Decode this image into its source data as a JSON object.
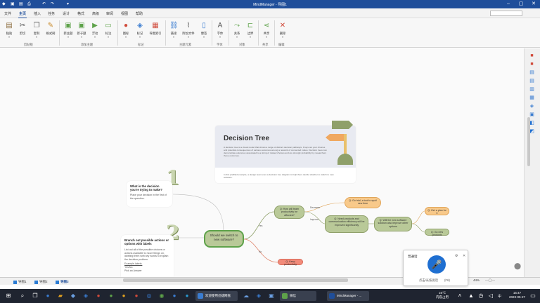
{
  "window": {
    "title": "MindManager - 导图1"
  },
  "menu": {
    "tabs": [
      "文件",
      "主页",
      "插入",
      "任务",
      "设计",
      "格式",
      "高级",
      "审阅",
      "视图",
      "帮助"
    ]
  },
  "ribbon": {
    "buttons": [
      "粘贴",
      "剪切",
      "复制",
      "格式刷",
      "新主题",
      "新子题",
      "浮动",
      "标注",
      "图标",
      "标记",
      "导图索引",
      "链接",
      "附加文件",
      "便签",
      "字体",
      "关系",
      "边界",
      "共享",
      "删除"
    ],
    "groups": [
      "剪贴板",
      "添加主题",
      "标记",
      "主题元素",
      "字体",
      "对象",
      "共享",
      "编辑"
    ]
  },
  "doc": {
    "title": "Decision Tree",
    "body": "A decision tree is a visual model that shows a range of distinct decision pathways. It lays out your choices and potential consequences of various outcomes among a network of connected nodes. Decision trees can demonstrate outcomes associated to a string of related choices and are strongly probability by researchers these outcomes.",
    "note": "In this prefilled example, a design team uses a decision tree diagram to help them decide whether to switch to new software."
  },
  "steps": [
    {
      "number": "1",
      "title": "What is the decision you're trying to make?",
      "text": "Place your decision in the first of the question."
    },
    {
      "number": "2",
      "title": "Branch out possible actions or options with labels",
      "text": "List out all of the possible choices or actions available to move things on, labeling them with key words to explain the decision problem.",
      "example_label": "Example labels:",
      "examples": [
        "Yes/No",
        "Pick an Answer"
      ]
    }
  ],
  "central_topic": "Should we switch to new software?",
  "nodes": {
    "n1": "Q: How will team productivity be affected?",
    "n2": "Q: Need products and communication efficiency will be improved significantly",
    "n3": "Q: Will the new software solution also improve other options",
    "n4": "Q: Go trial, a tool to spoil new time",
    "n5": "Q: Go new products",
    "n6": "Q: Get a plan for it",
    "n7": "Q: Keep productivity",
    "e_yes": "Yes",
    "e_no": "No",
    "e_decrease": "Decrease",
    "e_improve": "Improve"
  },
  "sheets": [
    "导图1",
    "导图2",
    "导图3"
  ],
  "zoom": "44%",
  "voice": {
    "title": "普通话",
    "hint": "点击/长按说话",
    "shortcut": "(F6)"
  },
  "taskbar": {
    "search_placeholder": "",
    "apps": [
      "欢迎使用迅捷网盘",
      "微信",
      "MindManager - ..."
    ],
    "weather": "16℃",
    "weather_sub": "内容占用",
    "ime": "中",
    "time": "15:47",
    "date": "2023-05-27"
  }
}
